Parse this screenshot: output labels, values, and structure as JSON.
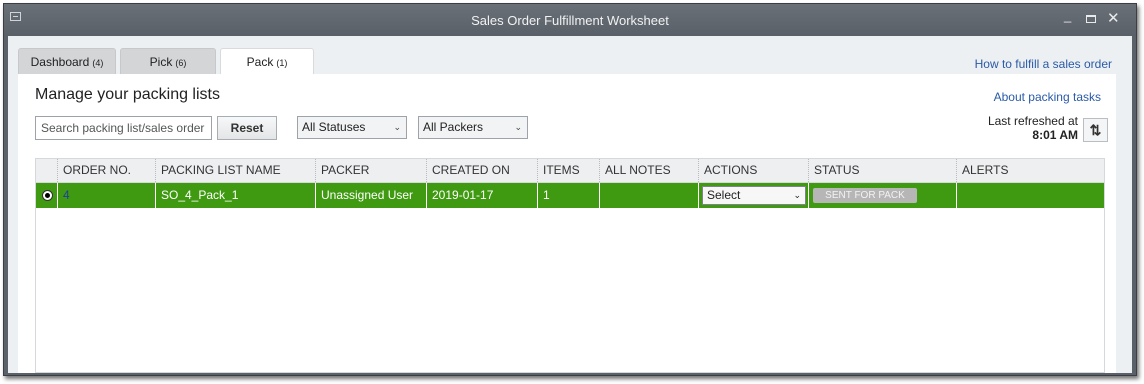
{
  "window": {
    "title": "Sales Order Fulfillment Worksheet"
  },
  "tabs": [
    {
      "label": "Dashboard",
      "count": "(4)"
    },
    {
      "label": "Pick",
      "count": "(6)"
    },
    {
      "label": "Pack",
      "count": "(1)"
    }
  ],
  "active_tab": "Pack",
  "help_link": "How to fulfill a sales order",
  "main": {
    "heading": "Manage your packing lists",
    "about_link": "About packing tasks",
    "search_placeholder": "Search packing list/sales order",
    "reset_label": "Reset",
    "status_filter": "All Statuses",
    "packer_filter": "All Packers",
    "refresh_label": "Last refreshed at",
    "refresh_time": "8:01 AM"
  },
  "table": {
    "columns": [
      "ORDER NO.",
      "PACKING LIST NAME",
      "PACKER",
      "CREATED ON",
      "ITEMS",
      "ALL NOTES",
      "ACTIONS",
      "STATUS",
      "ALERTS"
    ],
    "rows": [
      {
        "order_no": "4",
        "packing_list_name": "SO_4_Pack_1",
        "packer": "Unassigned User",
        "created_on": "2019-01-17",
        "items": "1",
        "all_notes": "",
        "action": "Select",
        "status": "SENT FOR PACK",
        "alerts": ""
      }
    ]
  },
  "colors": {
    "selected_row": "#3f9a12",
    "link": "#2a5aa8",
    "titlebar": "#5b6168"
  },
  "icons": [
    "system-menu-icon",
    "minimize-icon",
    "maximize-icon",
    "close-icon",
    "refresh-icon",
    "chevron-down-icon"
  ]
}
